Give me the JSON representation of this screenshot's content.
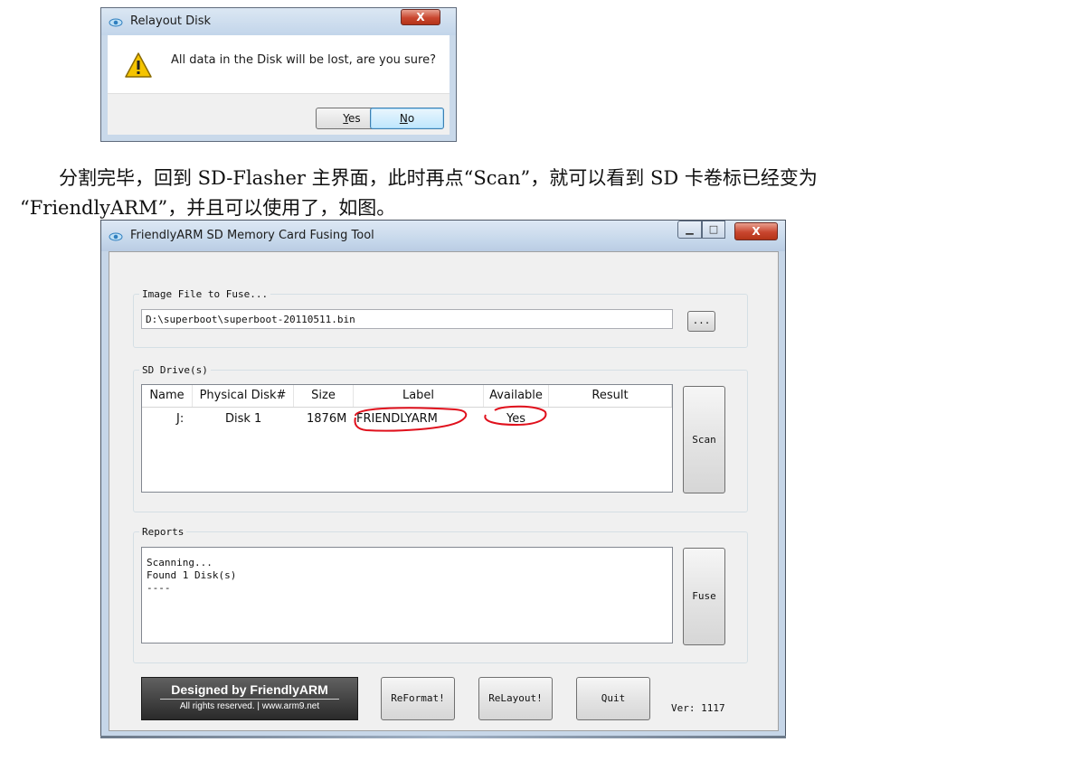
{
  "dialog": {
    "title": "Relayout Disk",
    "close_label": "X",
    "icon": "warning-icon",
    "message": "All data in the Disk will be lost, are you sure?",
    "yes_label": "Yes",
    "no_label": "No"
  },
  "paragraph": {
    "line1": "分割完毕，回到 SD-Flasher 主界面，此时再点“Scan”，就可以看到 SD 卡卷标已经变为",
    "line2": "“FriendlyARM”，并且可以使用了，如图。"
  },
  "window": {
    "title": "FriendlyARM SD Memory Card Fusing Tool",
    "close_label": "X",
    "image_group": {
      "legend": "Image File to Fuse...",
      "path_value": "D:\\superboot\\superboot-20110511.bin",
      "browse_label": "..."
    },
    "drives_group": {
      "legend": "SD Drive(s)",
      "columns": [
        "Name",
        "Physical Disk#",
        "Size",
        "Label",
        "Available",
        "Result"
      ],
      "rows": [
        {
          "name": "J:",
          "disk": "Disk 1",
          "size": "1876M",
          "label": "FRIENDLYARM",
          "available": "Yes",
          "result": ""
        }
      ],
      "scan_label": "Scan"
    },
    "reports_group": {
      "legend": "Reports",
      "text": "Scanning...\nFound 1 Disk(s)\n----",
      "fuse_label": "Fuse"
    },
    "banner": {
      "line1": "Designed by FriendlyARM",
      "line2": "All rights reserved. | www.arm9.net"
    },
    "reformat_label": "ReFormat!",
    "relayout_label": "ReLayout!",
    "quit_label": "Quit",
    "version": "Ver: 1117"
  },
  "annotation_color": "#e0101c"
}
